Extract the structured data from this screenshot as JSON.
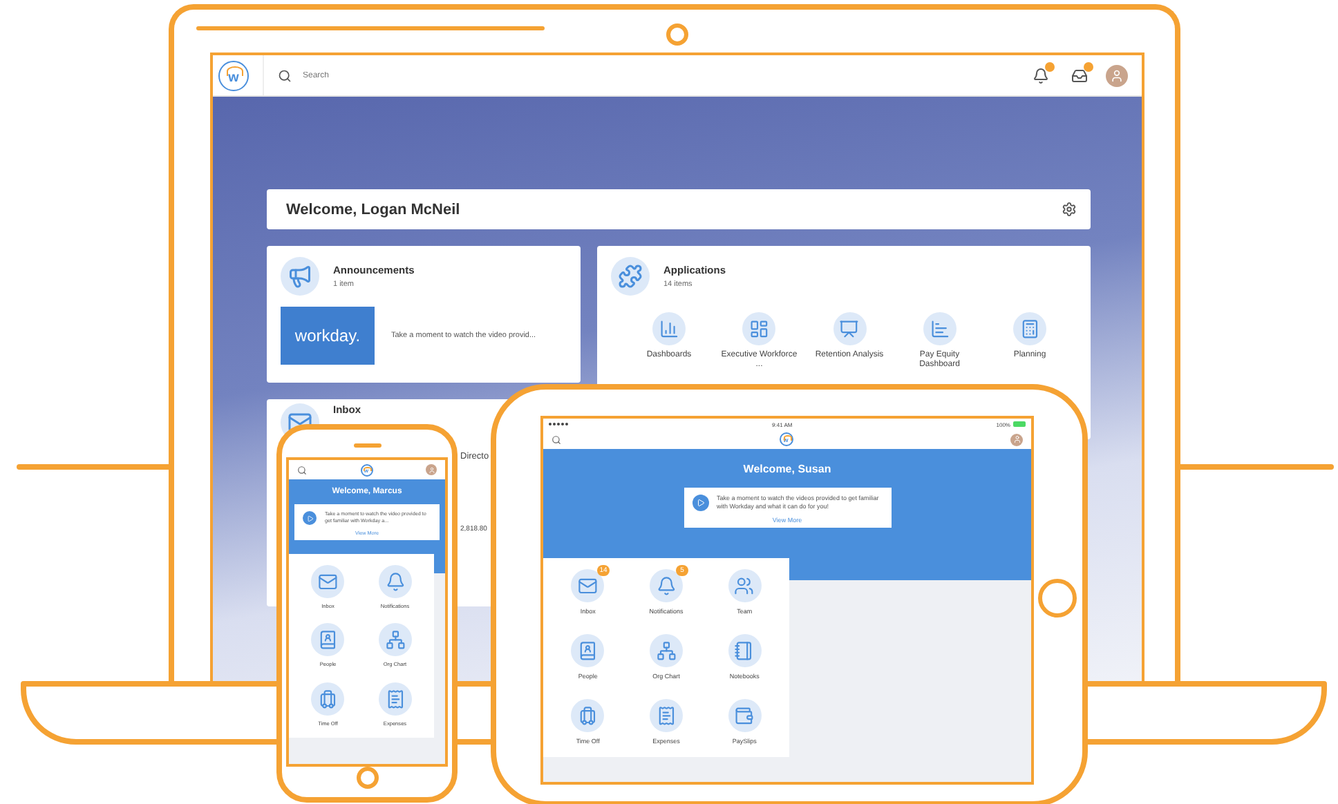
{
  "laptop": {
    "logo": "w",
    "search": {
      "placeholder": "Search"
    },
    "welcome": "Welcome, Logan McNeil",
    "announcements": {
      "title": "Announcements",
      "count": "1 item",
      "logo_text": "workday.",
      "text": "Take a moment to watch the video provid..."
    },
    "applications": {
      "title": "Applications",
      "count": "14 items",
      "apps": [
        {
          "label": "Dashboards",
          "kind": "dashboards"
        },
        {
          "label": "Executive Workforce ...",
          "kind": "workforce"
        },
        {
          "label": "Retention Analysis",
          "kind": "retention"
        },
        {
          "label": "Pay Equity Dashboard",
          "kind": "equity"
        },
        {
          "label": "Planning",
          "kind": "planning"
        }
      ]
    },
    "inbox": {
      "title": "Inbox",
      "fragments": [
        "Directo",
        "2,818.80"
      ]
    }
  },
  "phone": {
    "logo": "w",
    "welcome": "Welcome, Marcus",
    "message": "Take a moment to watch the video provided to get familiar with Workday a...",
    "link": "View More",
    "apps": [
      {
        "label": "Inbox",
        "kind": "inbox"
      },
      {
        "label": "Notifications",
        "kind": "notifications"
      },
      {
        "label": "People",
        "kind": "people"
      },
      {
        "label": "Org Chart",
        "kind": "orgchart"
      },
      {
        "label": "Time Off",
        "kind": "timeoff"
      },
      {
        "label": "Expenses",
        "kind": "expenses"
      }
    ]
  },
  "tablet": {
    "logo": "w",
    "status": {
      "time": "9:41 AM",
      "battery": "100%"
    },
    "welcome": "Welcome, Susan",
    "message": "Take a moment to watch the videos provided to get familiar with Workday and what it can do for you!",
    "link": "View More",
    "apps": [
      {
        "label": "Inbox",
        "kind": "inbox",
        "badge": "14"
      },
      {
        "label": "Notifications",
        "kind": "notifications",
        "badge": "5"
      },
      {
        "label": "Team",
        "kind": "team"
      },
      {
        "label": "People",
        "kind": "people"
      },
      {
        "label": "Org Chart",
        "kind": "orgchart"
      },
      {
        "label": "Notebooks",
        "kind": "notebooks"
      },
      {
        "label": "Time Off",
        "kind": "timeoff"
      },
      {
        "label": "Expenses",
        "kind": "expenses"
      },
      {
        "label": "PaySlips",
        "kind": "pay"
      }
    ]
  }
}
